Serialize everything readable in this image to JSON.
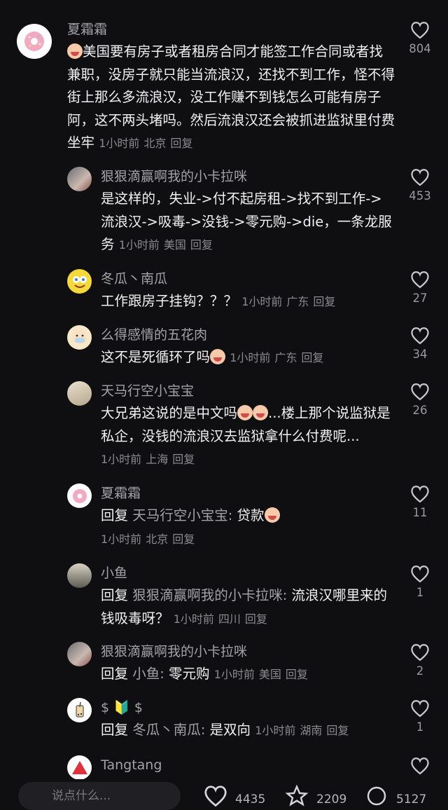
{
  "comments": [
    {
      "name": "夏霜霜",
      "text": "美国要有房子或者租房合同才能签工作合同或者找兼职，没房子就只能当流浪汉，还找不到工作，怪不得街上那么多流浪汉，没工作赚不到钱怎么可能有房子阿，这不两头堵吗。然后流浪汉还会被抓进监狱里付费坐牢",
      "time": "1小时前",
      "location": "北京",
      "reply": "回复",
      "likes": "804"
    },
    {
      "name": "狠狠滴赢啊我的小卡拉咪",
      "text": "是这样的，失业->付不起房租->找不到工作->流浪汉->吸毒->没钱->零元购->die，一条龙服务",
      "time": "1小时前",
      "location": "美国",
      "reply": "回复",
      "likes": "453"
    },
    {
      "name": "冬瓜丶南瓜",
      "text": "工作跟房子挂钩？？？",
      "time": "1小时前",
      "location": "广东",
      "reply": "回复",
      "likes": "27"
    },
    {
      "name": "么得感情的五花肉",
      "text": "这不是死循环了吗",
      "time": "1小时前",
      "location": "广东",
      "reply": "回复",
      "likes": "34"
    },
    {
      "name": "天马行空小宝宝",
      "text_a": "大兄弟这说的是中文吗",
      "text_b": "...楼上那个说监狱是私企，没钱的流浪汉去监狱拿什么付费呢...",
      "time": "1小时前",
      "location": "上海",
      "reply": "回复",
      "likes": "26"
    },
    {
      "name": "夏霜霜",
      "prefix": "回复",
      "target": "天马行空小宝宝:",
      "text": "贷款",
      "time": "1小时前",
      "location": "北京",
      "reply": "回复",
      "likes": "11"
    },
    {
      "name": "小鱼",
      "prefix": "回复",
      "target": "狠狠滴赢啊我的小卡拉咪:",
      "text": "流浪汉哪里来的钱吸毒呀？",
      "time": "1小时前",
      "location": "四川",
      "reply": "回复",
      "likes": "1"
    },
    {
      "name": "狠狠滴赢啊我的小卡拉咪",
      "prefix": "回复",
      "target": "小鱼:",
      "text": "零元购",
      "time": "1小时前",
      "location": "美国",
      "reply": "回复",
      "likes": "2"
    },
    {
      "name": "$ 🔰 $",
      "prefix": "回复",
      "target": "冬瓜丶南瓜:",
      "text": "是双向",
      "time": "1小时前",
      "location": "湖南",
      "reply": "回复",
      "likes": "1"
    },
    {
      "name": "Tangtang"
    }
  ],
  "bottom": {
    "input_placeholder": "说点什么...",
    "likes": "4435",
    "stars": "2209",
    "comments": "5127"
  },
  "colors": {
    "background": "#0f0f12",
    "text": "#f1f1f3",
    "muted": "#8a8a91"
  }
}
